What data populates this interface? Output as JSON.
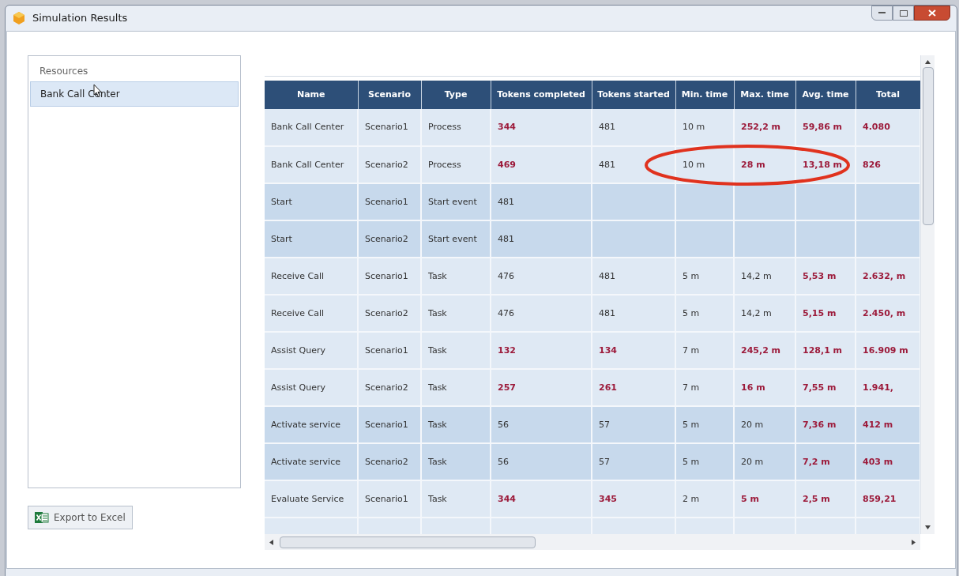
{
  "window": {
    "title": "Simulation Results"
  },
  "sidebar": {
    "heading": "Resources",
    "items": [
      {
        "label": "Bank Call Center",
        "selected": true
      }
    ]
  },
  "export_button": {
    "label": "Export to Excel"
  },
  "table": {
    "columns": [
      "Name",
      "Scenario",
      "Type",
      "Tokens completed",
      "Tokens started",
      "Min. time",
      "Max. time",
      "Avg. time",
      "Total"
    ],
    "rows": [
      {
        "shaded": false,
        "cells": [
          {
            "text": "Bank Call Center",
            "highlight": false
          },
          {
            "text": "Scenario1",
            "highlight": false
          },
          {
            "text": "Process",
            "highlight": false
          },
          {
            "text": "344",
            "highlight": true
          },
          {
            "text": "481",
            "highlight": false
          },
          {
            "text": "10 m",
            "highlight": false
          },
          {
            "text": "252,2 m",
            "highlight": true
          },
          {
            "text": "59,86 m",
            "highlight": true
          },
          {
            "text": "4.080",
            "highlight": true
          }
        ]
      },
      {
        "shaded": false,
        "circled": true,
        "cells": [
          {
            "text": "Bank Call Center",
            "highlight": false
          },
          {
            "text": "Scenario2",
            "highlight": false
          },
          {
            "text": "Process",
            "highlight": false
          },
          {
            "text": "469",
            "highlight": true
          },
          {
            "text": "481",
            "highlight": false
          },
          {
            "text": "10 m",
            "highlight": false
          },
          {
            "text": "28 m",
            "highlight": true
          },
          {
            "text": "13,18 m",
            "highlight": true
          },
          {
            "text": "826",
            "highlight": true
          }
        ]
      },
      {
        "shaded": true,
        "cells": [
          {
            "text": "Start",
            "highlight": false
          },
          {
            "text": "Scenario1",
            "highlight": false
          },
          {
            "text": "Start event",
            "highlight": false
          },
          {
            "text": "481",
            "highlight": false
          }
        ]
      },
      {
        "shaded": true,
        "cells": [
          {
            "text": "Start",
            "highlight": false
          },
          {
            "text": "Scenario2",
            "highlight": false
          },
          {
            "text": "Start event",
            "highlight": false
          },
          {
            "text": "481",
            "highlight": false
          }
        ]
      },
      {
        "shaded": false,
        "cells": [
          {
            "text": "Receive Call",
            "highlight": false
          },
          {
            "text": "Scenario1",
            "highlight": false
          },
          {
            "text": "Task",
            "highlight": false
          },
          {
            "text": "476",
            "highlight": false
          },
          {
            "text": "481",
            "highlight": false
          },
          {
            "text": "5 m",
            "highlight": false
          },
          {
            "text": "14,2 m",
            "highlight": false
          },
          {
            "text": "5,53 m",
            "highlight": true
          },
          {
            "text": "2.632, m",
            "highlight": true
          }
        ]
      },
      {
        "shaded": false,
        "cells": [
          {
            "text": "Receive Call",
            "highlight": false
          },
          {
            "text": "Scenario2",
            "highlight": false
          },
          {
            "text": "Task",
            "highlight": false
          },
          {
            "text": "476",
            "highlight": false
          },
          {
            "text": "481",
            "highlight": false
          },
          {
            "text": "5 m",
            "highlight": false
          },
          {
            "text": "14,2 m",
            "highlight": false
          },
          {
            "text": "5,15 m",
            "highlight": true
          },
          {
            "text": "2.450, m",
            "highlight": true
          }
        ]
      },
      {
        "shaded": false,
        "cells": [
          {
            "text": "Assist Query",
            "highlight": false
          },
          {
            "text": "Scenario1",
            "highlight": false
          },
          {
            "text": "Task",
            "highlight": false
          },
          {
            "text": "132",
            "highlight": true
          },
          {
            "text": "134",
            "highlight": true
          },
          {
            "text": "7 m",
            "highlight": false
          },
          {
            "text": "245,2 m",
            "highlight": true
          },
          {
            "text": "128,1 m",
            "highlight": true
          },
          {
            "text": "16.909 m",
            "highlight": true
          }
        ]
      },
      {
        "shaded": false,
        "cells": [
          {
            "text": "Assist Query",
            "highlight": false
          },
          {
            "text": "Scenario2",
            "highlight": false
          },
          {
            "text": "Task",
            "highlight": false
          },
          {
            "text": "257",
            "highlight": true
          },
          {
            "text": "261",
            "highlight": true
          },
          {
            "text": "7 m",
            "highlight": false
          },
          {
            "text": "16 m",
            "highlight": true
          },
          {
            "text": "7,55 m",
            "highlight": true
          },
          {
            "text": "1.941,",
            "highlight": true
          }
        ]
      },
      {
        "shaded": true,
        "cells": [
          {
            "text": "Activate service",
            "highlight": false
          },
          {
            "text": "Scenario1",
            "highlight": false
          },
          {
            "text": "Task",
            "highlight": false
          },
          {
            "text": "56",
            "highlight": false
          },
          {
            "text": "57",
            "highlight": false
          },
          {
            "text": "5 m",
            "highlight": false
          },
          {
            "text": "20 m",
            "highlight": false
          },
          {
            "text": "7,36 m",
            "highlight": true
          },
          {
            "text": "412 m",
            "highlight": true
          }
        ]
      },
      {
        "shaded": true,
        "cells": [
          {
            "text": "Activate service",
            "highlight": false
          },
          {
            "text": "Scenario2",
            "highlight": false
          },
          {
            "text": "Task",
            "highlight": false
          },
          {
            "text": "56",
            "highlight": false
          },
          {
            "text": "57",
            "highlight": false
          },
          {
            "text": "5 m",
            "highlight": false
          },
          {
            "text": "20 m",
            "highlight": false
          },
          {
            "text": "7,2 m",
            "highlight": true
          },
          {
            "text": "403 m",
            "highlight": true
          }
        ]
      },
      {
        "shaded": false,
        "cells": [
          {
            "text": "Evaluate Service",
            "highlight": false
          },
          {
            "text": "Scenario1",
            "highlight": false
          },
          {
            "text": "Task",
            "highlight": false
          },
          {
            "text": "344",
            "highlight": true
          },
          {
            "text": "345",
            "highlight": true
          },
          {
            "text": "2 m",
            "highlight": false
          },
          {
            "text": "5 m",
            "highlight": true
          },
          {
            "text": "2,5 m",
            "highlight": true
          },
          {
            "text": "859,21",
            "highlight": true
          }
        ]
      }
    ]
  }
}
